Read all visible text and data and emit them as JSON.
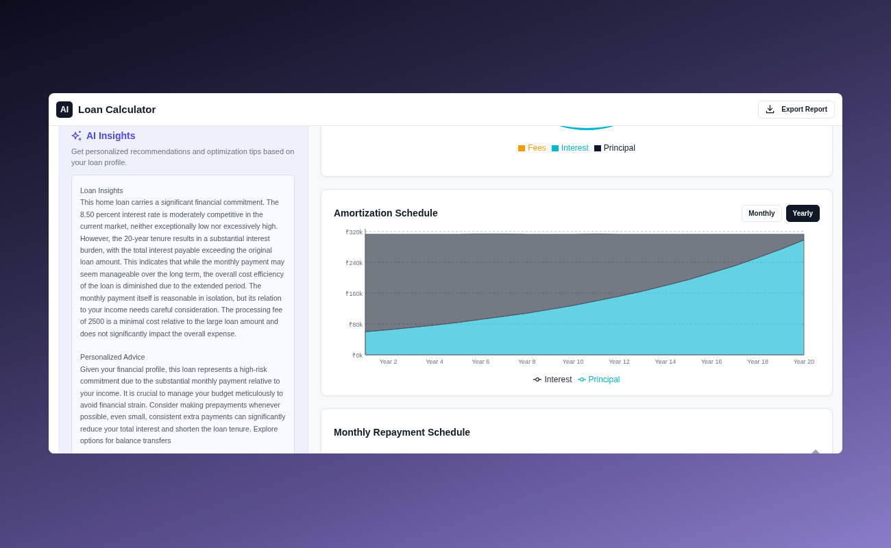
{
  "app": {
    "logo": "AI",
    "title": "Loan Calculator",
    "export_button": "Export Report"
  },
  "insights": {
    "title": "AI Insights",
    "subtitle": "Get personalized recommendations and optimization tips based on your loan profile.",
    "sections": [
      {
        "heading": "Loan Insights",
        "body": "This home loan carries a significant financial commitment. The 8.50 percent interest rate is moderately competitive in the current market, neither exceptionally low nor excessively high. However, the 20-year tenure results in a substantial interest burden, with the total interest payable exceeding the original loan amount. This indicates that while the monthly payment may seem manageable over the long term, the overall cost efficiency of the loan is diminished due to the extended period. The monthly payment itself is reasonable in isolation, but its relation to your income needs careful consideration. The processing fee of 2500 is a minimal cost relative to the large loan amount and does not significantly impact the overall expense."
      },
      {
        "heading": "Personalized Advice",
        "body": "Given your financial profile, this loan represents a high-risk commitment due to the substantial monthly payment relative to your income. It is crucial to manage your budget meticulously to avoid financial strain. Consider making prepayments whenever possible, even small, consistent extra payments can significantly reduce your total interest and shorten the loan tenure. Explore options for balance transfers"
      }
    ]
  },
  "breakdown": {
    "legend": [
      {
        "label": "Fees",
        "color": "#f59e0b"
      },
      {
        "label": "Interest",
        "color": "#06b6d4"
      },
      {
        "label": "Principal",
        "color": "#0f172a"
      }
    ]
  },
  "amortization": {
    "title": "Amortization Schedule",
    "toggles": [
      {
        "label": "Monthly",
        "selected": false
      },
      {
        "label": "Yearly",
        "selected": true
      }
    ],
    "chart_data": {
      "type": "area",
      "stacked": true,
      "grid": true,
      "legend": "bottom",
      "categories": [
        null,
        "Year 2",
        null,
        "Year 4",
        null,
        "Year 6",
        null,
        "Year 8",
        null,
        "Year 10",
        null,
        "Year 12",
        null,
        "Year 14",
        null,
        "Year 16",
        null,
        "Year 18",
        null,
        "Year 20"
      ],
      "ylim": [
        0,
        320
      ],
      "yticks": [
        {
          "value": 0,
          "label": "₹0k"
        },
        {
          "value": 80,
          "label": "₹80k"
        },
        {
          "value": 160,
          "label": "₹160k"
        },
        {
          "value": 240,
          "label": "₹240k"
        },
        {
          "value": 320,
          "label": "₹320k"
        }
      ],
      "series": [
        {
          "name": "Interest",
          "color": "#1f2937",
          "values": [
            253,
            248,
            242,
            236,
            229,
            222,
            214,
            205,
            195,
            185,
            174,
            161,
            148,
            133,
            118,
            100,
            82,
            61,
            39,
            15
          ]
        },
        {
          "name": "Principal",
          "color": "#06b6d4",
          "values": [
            60,
            65,
            71,
            77,
            84,
            92,
            100,
            108,
            118,
            128,
            140,
            152,
            165,
            180,
            195,
            213,
            231,
            252,
            274,
            298
          ]
        }
      ]
    }
  },
  "repayment": {
    "title": "Monthly Repayment Schedule"
  }
}
